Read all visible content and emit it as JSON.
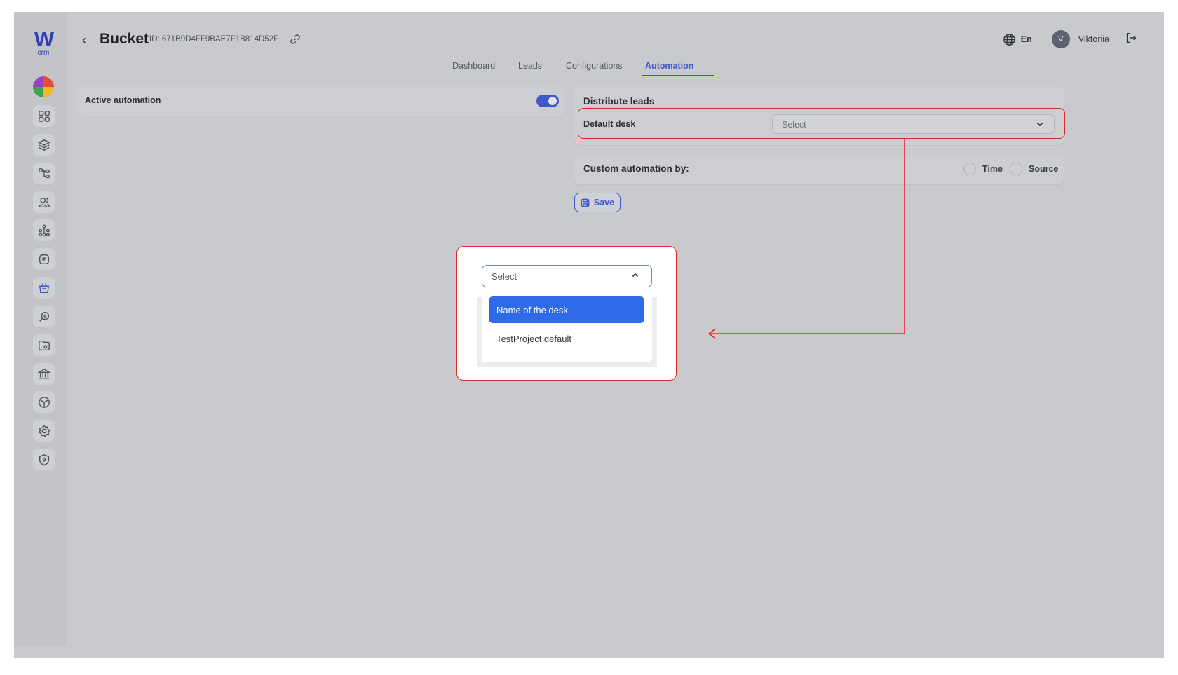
{
  "app": {
    "logo_text": "W",
    "logo_sub": "crm"
  },
  "header": {
    "back_glyph": "‹",
    "title": "Bucket",
    "id_text": "ID: 671B9D4FF9BAE7F1B814D52F",
    "language": "En",
    "avatar_initial": "V",
    "username": "Viktoriia"
  },
  "tabs": [
    {
      "label": "Dashboard",
      "active": false
    },
    {
      "label": "Leads",
      "active": false
    },
    {
      "label": "Configurations",
      "active": false
    },
    {
      "label": "Automation",
      "active": true
    }
  ],
  "active_automation": {
    "label": "Active automation",
    "enabled": true
  },
  "distribute": {
    "title": "Distribute leads",
    "default_desk_label": "Default desk",
    "select_placeholder": "Select"
  },
  "custom_automation": {
    "label": "Custom automation by:",
    "options": [
      "Time",
      "Source"
    ]
  },
  "save_label": "Save",
  "callout": {
    "select_placeholder": "Select",
    "options": [
      "Name of the desk",
      "TestProject default"
    ],
    "highlighted_index": 0
  },
  "sidebar_icons": [
    "dashboard-icon",
    "layers-icon",
    "hierarchy-icon",
    "users-icon",
    "network-icon",
    "notes-icon",
    "bucket-icon",
    "search-key-icon",
    "folder-icon",
    "bank-icon",
    "cube-icon",
    "settings-icon",
    "shield-icon"
  ],
  "colors": {
    "accent": "#3f57c8",
    "highlight": "#2f6be8",
    "annotation": "#e02a2a",
    "overlay": "#c9cacd"
  }
}
